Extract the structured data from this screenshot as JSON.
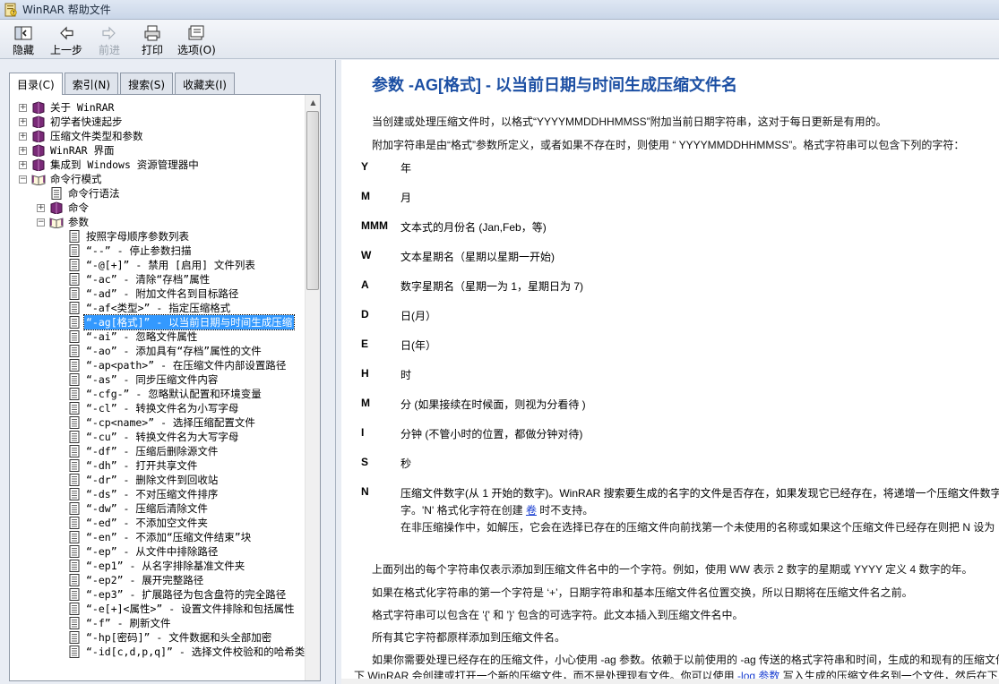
{
  "window": {
    "title": "WinRAR 帮助文件"
  },
  "toolbar": {
    "hide": "隐藏",
    "back": "上一步",
    "forward": "前进",
    "print": "打印",
    "options": "选项(O)"
  },
  "tabs": [
    {
      "label": "目录(C)"
    },
    {
      "label": "索引(N)"
    },
    {
      "label": "搜索(S)"
    },
    {
      "label": "收藏夹(I)"
    }
  ],
  "tree": {
    "items": [
      {
        "label": "关于 WinRAR",
        "level": 0,
        "type": "book",
        "expander": "+"
      },
      {
        "label": "初学者快速起步",
        "level": 0,
        "type": "book",
        "expander": "+"
      },
      {
        "label": "压缩文件类型和参数",
        "level": 0,
        "type": "book",
        "expander": "+"
      },
      {
        "label": "WinRAR 界面",
        "level": 0,
        "type": "book",
        "expander": "+"
      },
      {
        "label": "集成到 Windows 资源管理器中",
        "level": 0,
        "type": "book",
        "expander": "+"
      },
      {
        "label": "命令行模式",
        "level": 0,
        "type": "open-book",
        "expander": "−"
      },
      {
        "label": "命令行语法",
        "level": 1,
        "type": "page",
        "expander": ""
      },
      {
        "label": "命令",
        "level": 1,
        "type": "book",
        "expander": "+"
      },
      {
        "label": "参数",
        "level": 1,
        "type": "open-book",
        "expander": "−"
      },
      {
        "label": "按照字母顺序参数列表",
        "level": 2,
        "type": "page",
        "expander": ""
      },
      {
        "label": "“--” - 停止参数扫描",
        "level": 2,
        "type": "page",
        "expander": ""
      },
      {
        "label": "“-@[+]” - 禁用 [启用] 文件列表",
        "level": 2,
        "type": "page",
        "expander": ""
      },
      {
        "label": "“-ac” - 清除“存档”属性",
        "level": 2,
        "type": "page",
        "expander": ""
      },
      {
        "label": "“-ad” - 附加文件名到目标路径",
        "level": 2,
        "type": "page",
        "expander": ""
      },
      {
        "label": "“-af<类型>” - 指定压缩格式",
        "level": 2,
        "type": "page",
        "expander": ""
      },
      {
        "label": "“-ag[格式]” - 以当前日期与时间生成压缩",
        "level": 2,
        "type": "page",
        "expander": "",
        "selected": true
      },
      {
        "label": "“-ai” - 忽略文件属性",
        "level": 2,
        "type": "page",
        "expander": ""
      },
      {
        "label": "“-ao” - 添加具有“存档”属性的文件",
        "level": 2,
        "type": "page",
        "expander": ""
      },
      {
        "label": "“-ap<path>” - 在压缩文件内部设置路径",
        "level": 2,
        "type": "page",
        "expander": ""
      },
      {
        "label": "“-as” - 同步压缩文件内容",
        "level": 2,
        "type": "page",
        "expander": ""
      },
      {
        "label": "“-cfg-” - 忽略默认配置和环境变量",
        "level": 2,
        "type": "page",
        "expander": ""
      },
      {
        "label": "“-cl” - 转换文件名为小写字母",
        "level": 2,
        "type": "page",
        "expander": ""
      },
      {
        "label": "“-cp<name>” - 选择压缩配置文件",
        "level": 2,
        "type": "page",
        "expander": ""
      },
      {
        "label": "“-cu” - 转换文件名为大写字母",
        "level": 2,
        "type": "page",
        "expander": ""
      },
      {
        "label": "“-df” - 压缩后删除源文件",
        "level": 2,
        "type": "page",
        "expander": ""
      },
      {
        "label": "“-dh” - 打开共享文件",
        "level": 2,
        "type": "page",
        "expander": ""
      },
      {
        "label": "“-dr” - 删除文件到回收站",
        "level": 2,
        "type": "page",
        "expander": ""
      },
      {
        "label": "“-ds” - 不对压缩文件排序",
        "level": 2,
        "type": "page",
        "expander": ""
      },
      {
        "label": "“-dw” - 压缩后清除文件",
        "level": 2,
        "type": "page",
        "expander": ""
      },
      {
        "label": "“-ed” - 不添加空文件夹",
        "level": 2,
        "type": "page",
        "expander": ""
      },
      {
        "label": "“-en” - 不添加“压缩文件结束”块",
        "level": 2,
        "type": "page",
        "expander": ""
      },
      {
        "label": "“-ep” - 从文件中排除路径",
        "level": 2,
        "type": "page",
        "expander": ""
      },
      {
        "label": "“-ep1” - 从名字排除基准文件夹",
        "level": 2,
        "type": "page",
        "expander": ""
      },
      {
        "label": "“-ep2” - 展开完整路径",
        "level": 2,
        "type": "page",
        "expander": ""
      },
      {
        "label": "“-ep3” - 扩展路径为包含盘符的完全路径",
        "level": 2,
        "type": "page",
        "expander": ""
      },
      {
        "label": "“-e[+]<属性>” - 设置文件排除和包括属性",
        "level": 2,
        "type": "page",
        "expander": ""
      },
      {
        "label": "“-f” - 刷新文件",
        "level": 2,
        "type": "page",
        "expander": ""
      },
      {
        "label": "“-hp[密码]” - 文件数据和头全部加密",
        "level": 2,
        "type": "page",
        "expander": ""
      },
      {
        "label": "“-id[c,d,p,q]” - 选择文件校验和的哈希类型",
        "level": 2,
        "type": "page",
        "expander": ""
      }
    ]
  },
  "content": {
    "heading": "参数 -AG[格式] - 以当前日期与时间生成压缩文件名",
    "intro1": "当创建或处理压缩文件时，以格式“YYYYMMDDHHMMSS”附加当前日期字符串，这对于每日更新是有用的。",
    "intro2": "附加字符串是由“格式”参数所定义，或者如果不存在时，则使用 “ YYYYMMDDHHMMSS”。格式字符串可以包含下列的字符：",
    "formats": [
      {
        "key": "Y",
        "desc": "年"
      },
      {
        "key": "M",
        "desc": "月"
      },
      {
        "key": "MMM",
        "desc": "文本式的月份名 (Jan,Feb，等)"
      },
      {
        "key": "W",
        "desc": "文本星期名（星期以星期一开始)"
      },
      {
        "key": "A",
        "desc": "数字星期名（星期一为 1，星期日为 7)"
      },
      {
        "key": "D",
        "desc": "日(月）"
      },
      {
        "key": "E",
        "desc": "日(年）"
      },
      {
        "key": "H",
        "desc": "时"
      },
      {
        "key": "M",
        "desc": "分 (如果接续在时候面，则视为分看待 )"
      },
      {
        "key": "I",
        "desc": "分钟 (不管小时的位置，都做分钟对待)"
      },
      {
        "key": "S",
        "desc": "秒"
      },
      {
        "key": "N",
        "desc": "压缩文件数字(从 1 开始的数字)。WinRAR 搜索要生成的名字的文件是否存在，如果发现它已经存在，将递增一个压缩文件数字"
      }
    ],
    "n_line2_pre": "字。'N' 格式化字符在创建",
    "n_line2_link": "卷",
    "n_line2_post": "时不支持。",
    "n_line3": "在非压缩操作中，如解压，它会在选择已存在的压缩文件向前找第一个未使用的名称或如果这个压缩文件已经存在则把 N 设为",
    "para1": "上面列出的每个字符串仅表示添加到压缩文件名中的一个字符。例如，使用 WW 表示 2 数字的星期或 YYYY 定义 4 数字的年。",
    "para2": "如果在格式化字符串的第一个字符是 ‘+’，日期字符串和基本压缩文件名位置交换，所以日期将在压缩文件名之前。",
    "para3": "格式字符串可以包含在 '{' 和 '}' 包含的可选字符。此文本插入到压缩文件名中。",
    "para4": "所有其它字符都原样添加到压缩文件名。",
    "para5": "如果你需要处理已经存在的压缩文件，小心使用 -ag 参数。依赖于以前使用的 -ag 传送的格式字符串和时间，生成的和现有的压缩文件",
    "para6_pre": "下 WinRAR 会创建或打开一个新的压缩文件，而不是处理现有文件。你可以使用",
    "para6_link": "-log 参数",
    "para6_post": "写入生成的压缩文件名到一个文件，然后在下"
  }
}
